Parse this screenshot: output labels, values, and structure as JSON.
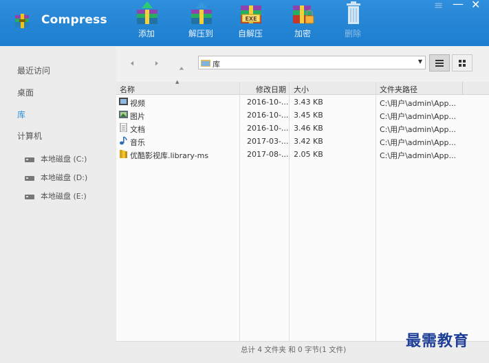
{
  "app": {
    "title": "Compress"
  },
  "toolbar": {
    "add_label": "添加",
    "extract_to_label": "解压到",
    "self_extract_label": "自解压",
    "encrypt_label": "加密",
    "delete_label": "删除"
  },
  "window_controls": {
    "menu": "≡",
    "minimize": "—",
    "close": "✕"
  },
  "sidebar": {
    "items": [
      {
        "label": "最近访问",
        "active": false
      },
      {
        "label": "桌面",
        "active": false
      },
      {
        "label": "库",
        "active": true
      },
      {
        "label": "计算机",
        "active": false
      }
    ],
    "drives": [
      {
        "label": "本地磁盘 (C:)"
      },
      {
        "label": "本地磁盘 (D:)"
      },
      {
        "label": "本地磁盘 (E:)"
      }
    ]
  },
  "address": {
    "path": "库"
  },
  "columns": {
    "name": "名称",
    "modified": "修改日期",
    "size": "大小",
    "folder_path": "文件夹路径"
  },
  "rows": [
    {
      "name": "视频",
      "modified": "2016-10-...",
      "size": "3.43 KB",
      "path": "C:\\用户\\admin\\App...",
      "icon": "video-library-icon"
    },
    {
      "name": "图片",
      "modified": "2016-10-...",
      "size": "3.45 KB",
      "path": "C:\\用户\\admin\\App...",
      "icon": "picture-library-icon"
    },
    {
      "name": "文档",
      "modified": "2016-10-...",
      "size": "3.46 KB",
      "path": "C:\\用户\\admin\\App...",
      "icon": "document-library-icon"
    },
    {
      "name": "音乐",
      "modified": "2017-03-...",
      "size": "3.42 KB",
      "path": "C:\\用户\\admin\\App...",
      "icon": "music-library-icon"
    },
    {
      "name": "优酷影视库.library-ms",
      "modified": "2017-08-...",
      "size": "2.05 KB",
      "path": "C:\\用户\\admin\\App...",
      "icon": "folder-library-icon"
    }
  ],
  "status": {
    "summary": "总计 4 文件夹 和 0 字节(1 文件)"
  },
  "watermark": "最需教育",
  "colors": {
    "topbar": "#2f8fdc",
    "active_nav": "#2f8fdc",
    "sidebar_bg": "#ececec"
  }
}
